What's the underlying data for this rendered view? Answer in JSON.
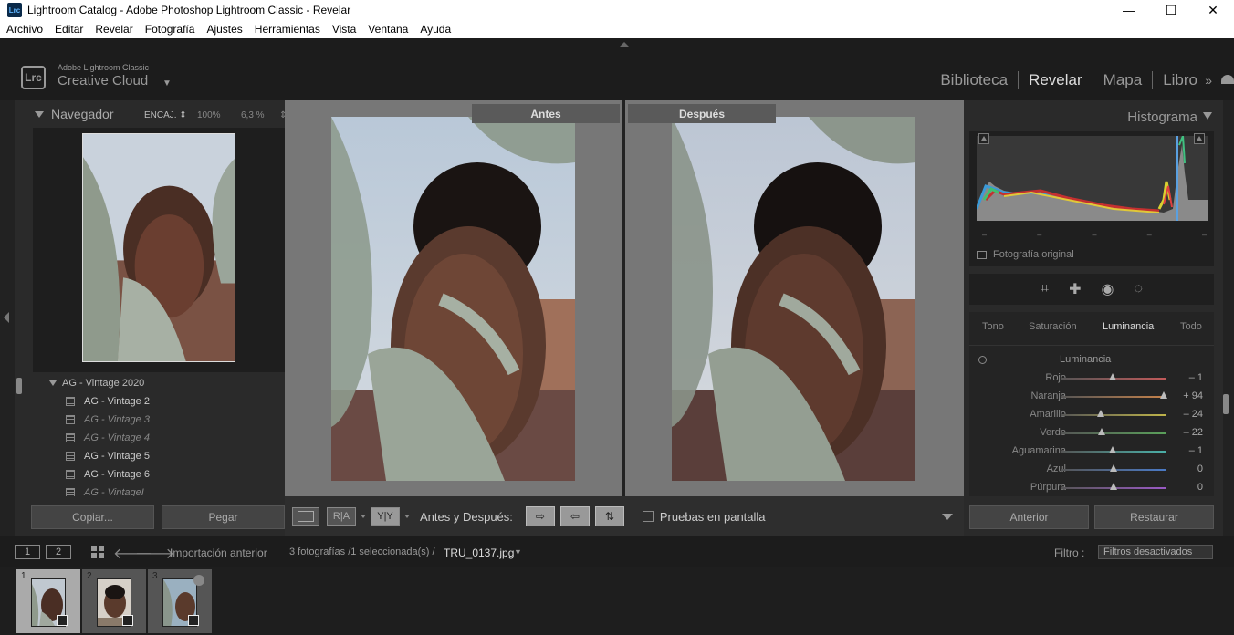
{
  "window": {
    "title": "Lightroom Catalog - Adobe Photoshop Lightroom Classic - Revelar",
    "app_icon": "Lrc",
    "controls": [
      "—",
      "☐",
      "✕"
    ]
  },
  "menu": [
    "Archivo",
    "Editar",
    "Revelar",
    "Fotografía",
    "Ajustes",
    "Herramientas",
    "Vista",
    "Ventana",
    "Ayuda"
  ],
  "brand": {
    "logo": "Lrc",
    "small": "Adobe Lightroom Classic",
    "large": "Creative Cloud",
    "caret": "▼"
  },
  "modules": {
    "items": [
      "Biblioteca",
      "Revelar",
      "Mapa",
      "Libro"
    ],
    "active": "Revelar",
    "more": "»"
  },
  "navigator": {
    "title": "Navegador",
    "zoom_fit": "ENCAJ. ⇕",
    "zoom_100": "100%",
    "zoom_pct": "6,3 %",
    "zoom_more": "⇕"
  },
  "presets": {
    "group": "AG - Vintage 2020",
    "items": [
      {
        "label": "AG - Vintage 2",
        "style": "light"
      },
      {
        "label": "AG - Vintage 3",
        "style": "dim"
      },
      {
        "label": "AG - Vintage 4",
        "style": "dim"
      },
      {
        "label": "AG - Vintage 5",
        "style": "light"
      },
      {
        "label": "AG - Vintage 6",
        "style": "light"
      },
      {
        "label": "AG - VintageI",
        "style": "dim"
      }
    ]
  },
  "left_buttons": {
    "copy": "Copiar...",
    "paste": "Pegar"
  },
  "compare": {
    "before": "Antes",
    "after": "Después"
  },
  "toolbar": {
    "ra": "R|A",
    "yy": "Y|Y",
    "before_after_label": "Antes y Después:",
    "btn1": "⇨",
    "btn2": "⇦",
    "btn3": "⇅",
    "proof": "Pruebas en pantalla"
  },
  "histogram": {
    "title": "Histograma",
    "ticks": [
      "–",
      "–",
      "–",
      "–",
      "–"
    ],
    "original": "Fotografía original"
  },
  "tools": [
    "⌗",
    "✚",
    "◉",
    "◌"
  ],
  "hsl": {
    "tabs": [
      "Tono",
      "Saturación",
      "Luminancia",
      "Todo"
    ],
    "active": "Luminancia",
    "section_title": "Luminancia",
    "sliders": [
      {
        "name": "Rojo",
        "value": "– 1",
        "num": -1,
        "color": "#c25a5a"
      },
      {
        "name": "Naranja",
        "value": "+ 94",
        "num": 94,
        "color": "#c6824a"
      },
      {
        "name": "Amarillo",
        "value": "– 24",
        "num": -24,
        "color": "#bfb44a"
      },
      {
        "name": "Verde",
        "value": "– 22",
        "num": -22,
        "color": "#5aa05a"
      },
      {
        "name": "Aguamarina",
        "value": "– 1",
        "num": -1,
        "color": "#4ab0a8"
      },
      {
        "name": "Azul",
        "value": "0",
        "num": 0,
        "color": "#4a7ac6"
      },
      {
        "name": "Púrpura",
        "value": "0",
        "num": 0,
        "color": "#9a5ac6"
      }
    ]
  },
  "right_buttons": {
    "previous": "Anterior",
    "reset": "Restaurar"
  },
  "filmstrip_header": {
    "screen1": "1",
    "screen2": "2",
    "source": "Importación anterior",
    "count": "3 fotografías /1 seleccionada(s) /",
    "filename": "TRU_0137.jpg",
    "filename_caret": "▼",
    "filter_label": "Filtro :",
    "filter_value": "Filtros desactivados"
  },
  "filmstrip": [
    {
      "index": "1",
      "selected": true
    },
    {
      "index": "2",
      "selected": false
    },
    {
      "index": "3",
      "selected": false
    }
  ]
}
